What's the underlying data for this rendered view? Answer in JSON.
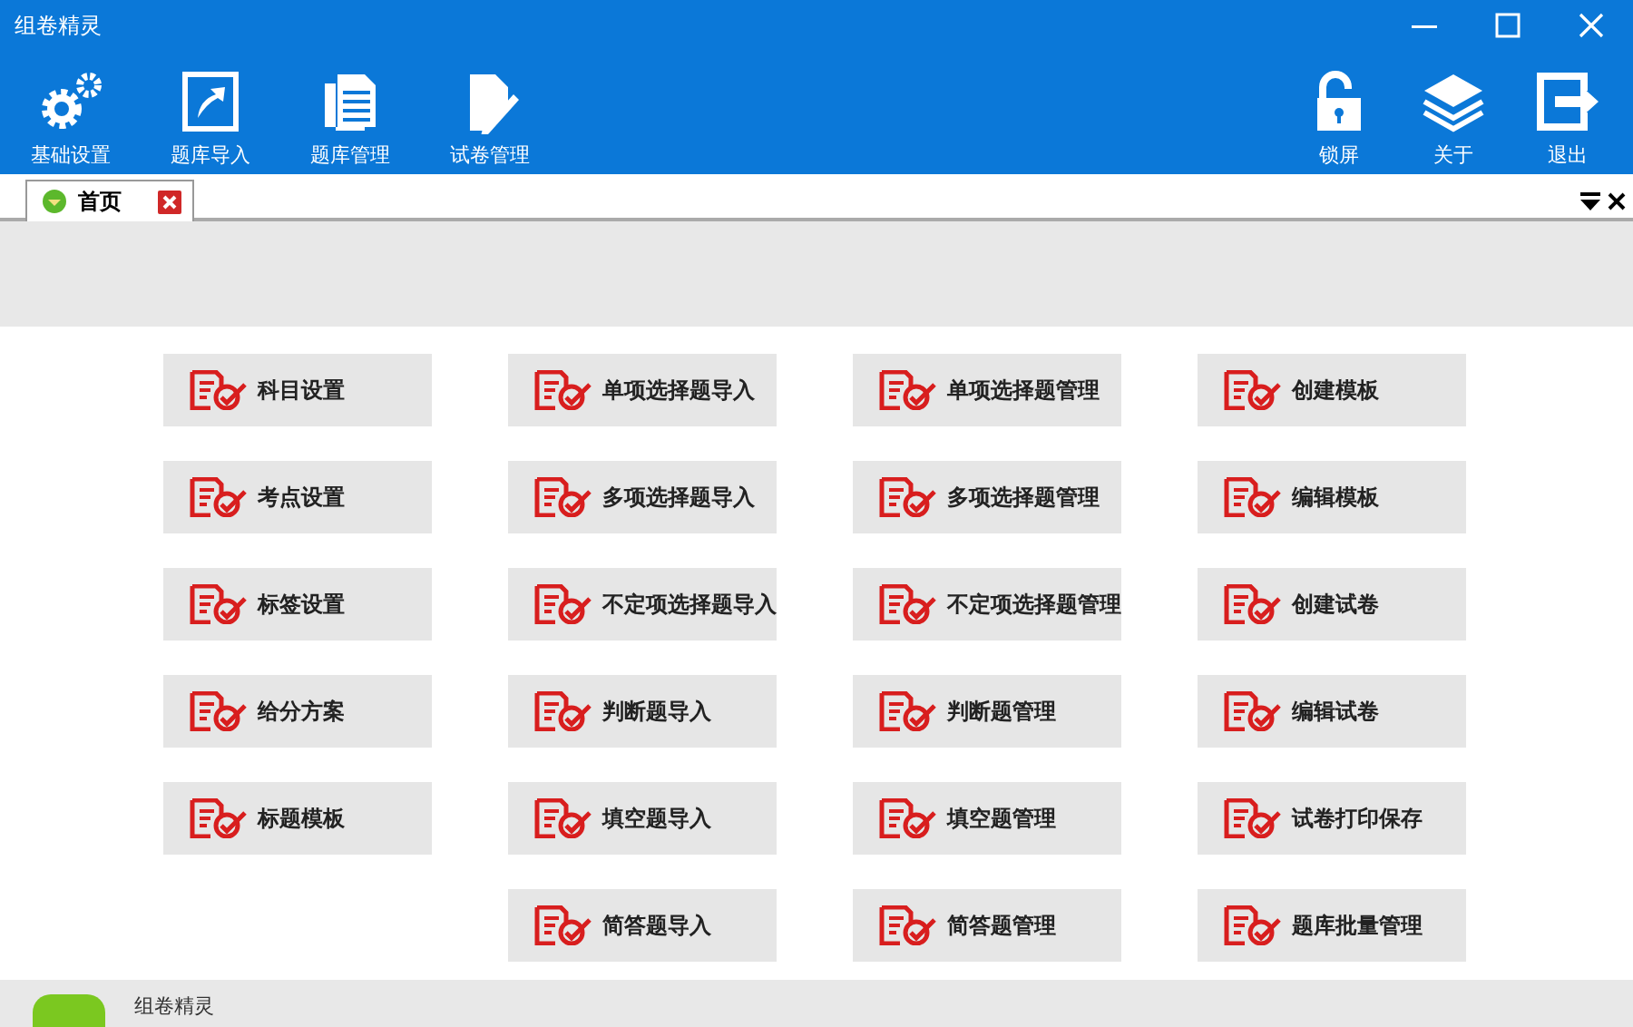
{
  "window": {
    "title": "组卷精灵"
  },
  "toolbar_left": [
    {
      "label": "基础设置",
      "kind": "gears"
    },
    {
      "label": "题库导入",
      "kind": "import"
    },
    {
      "label": "题库管理",
      "kind": "doc"
    },
    {
      "label": "试卷管理",
      "kind": "pen"
    }
  ],
  "toolbar_right": [
    {
      "label": "锁屏",
      "kind": "lock"
    },
    {
      "label": "关于",
      "kind": "layers"
    },
    {
      "label": "退出",
      "kind": "exit"
    }
  ],
  "tabs": [
    {
      "label": "首页",
      "selected": true
    }
  ],
  "columns": [
    {
      "buttons": [
        "科目设置",
        "考点设置",
        "标签设置",
        "给分方案",
        "标题模板"
      ]
    },
    {
      "buttons": [
        "单项选择题导入",
        "多项选择题导入",
        "不定项选择题导入",
        "判断题导入",
        "填空题导入",
        "简答题导入"
      ]
    },
    {
      "buttons": [
        "单项选择题管理",
        "多项选择题管理",
        "不定项选择题管理",
        "判断题管理",
        "填空题管理",
        "简答题管理"
      ]
    },
    {
      "buttons": [
        "创建模板",
        "编辑模板",
        "创建试卷",
        "编辑试卷",
        "试卷打印保存",
        "题库批量管理"
      ]
    }
  ],
  "footer": {
    "text": "组卷精灵"
  }
}
